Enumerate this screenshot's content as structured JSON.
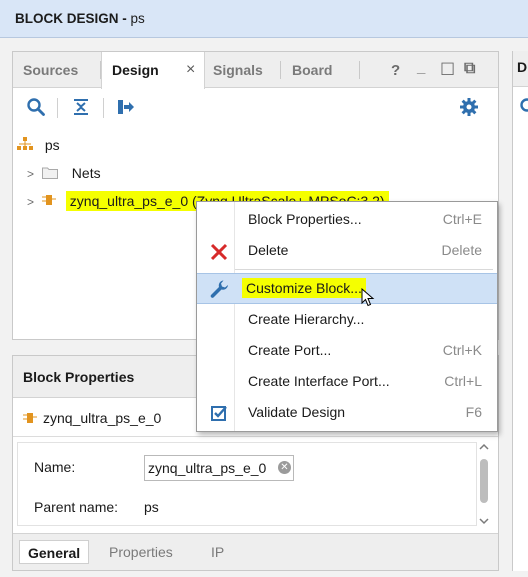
{
  "title": {
    "label": "BLOCK DESIGN",
    "separator": " - ",
    "design_name": "ps"
  },
  "tabs": [
    {
      "label": "Sources",
      "active": false
    },
    {
      "label": "Design",
      "active": true,
      "close": "×"
    },
    {
      "label": "Signals",
      "active": false
    },
    {
      "label": "Board",
      "active": false
    }
  ],
  "window_controls": {
    "help": "?",
    "minimize": "_",
    "restore": "☐",
    "float": "⧉"
  },
  "toolbar": {
    "icons": [
      "search-icon",
      "collapse-all-icon",
      "expand-all-icon",
      "gear-icon"
    ]
  },
  "tree": {
    "root": "ps",
    "items": [
      {
        "label": "Nets",
        "icon": "folder-icon"
      },
      {
        "label": "zynq_ultra_ps_e_0 (Zynq UltraScale+ MPSoC:3.2)",
        "icon": "ip-block-icon",
        "highlighted": true
      }
    ]
  },
  "right_panel": {
    "tab_initial": "D"
  },
  "context_menu": {
    "items": [
      {
        "label": "Block Properties...",
        "shortcut": "Ctrl+E",
        "icon": ""
      },
      {
        "label": "Delete",
        "shortcut": "Delete",
        "icon": "delete-x-icon"
      },
      {
        "label": "Customize Block...",
        "shortcut": "",
        "icon": "wrench-icon",
        "selected": true
      },
      {
        "label": "Create Hierarchy...",
        "shortcut": "",
        "icon": ""
      },
      {
        "label": "Create Port...",
        "shortcut": "Ctrl+K",
        "icon": ""
      },
      {
        "label": "Create Interface Port...",
        "shortcut": "Ctrl+L",
        "icon": ""
      },
      {
        "label": "Validate Design",
        "shortcut": "F6",
        "icon": "checkbox-icon"
      }
    ]
  },
  "block_properties": {
    "title": "Block Properties",
    "selected_block": "zynq_ultra_ps_e_0",
    "fields": {
      "name_label": "Name:",
      "name_value": "zynq_ultra_ps_e_0",
      "parent_label": "Parent name:",
      "parent_value": "ps"
    },
    "tabs": [
      {
        "label": "General",
        "active": true
      },
      {
        "label": "Properties",
        "active": false
      },
      {
        "label": "IP",
        "active": false
      }
    ]
  },
  "colors": {
    "title_bar": "#d9e6f7",
    "highlight": "#f5ff00",
    "menu_selection": "#cfe1f6",
    "accent_blue": "#2f6fae",
    "delete_red": "#d72a2a"
  }
}
